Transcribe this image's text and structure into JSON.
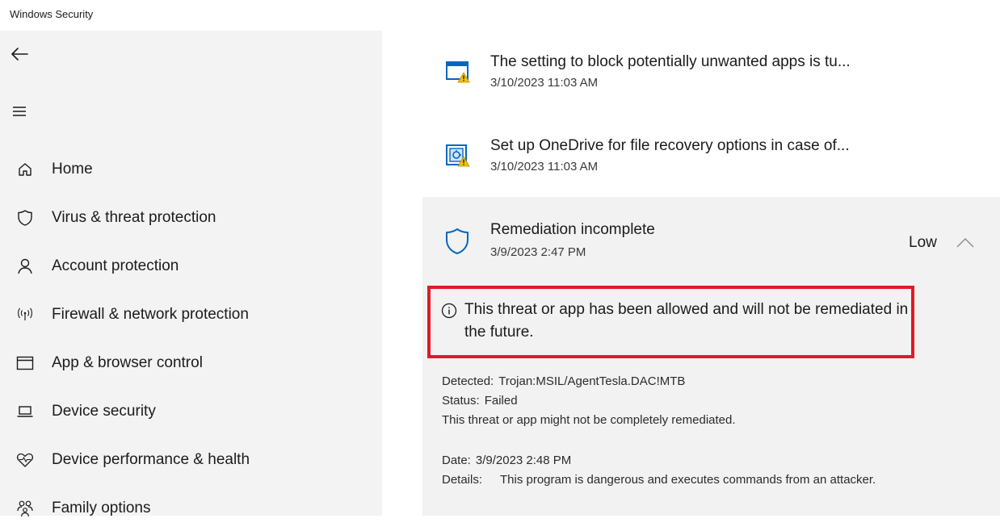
{
  "window": {
    "title": "Windows Security"
  },
  "sidebar": {
    "back_icon": "back-arrow-icon",
    "menu_icon": "hamburger-menu-icon",
    "items": [
      {
        "label": "Home",
        "icon": "home-icon"
      },
      {
        "label": "Virus & threat protection",
        "icon": "shield-icon"
      },
      {
        "label": "Account protection",
        "icon": "person-icon"
      },
      {
        "label": "Firewall & network protection",
        "icon": "antenna-icon"
      },
      {
        "label": "App & browser control",
        "icon": "browser-window-icon"
      },
      {
        "label": "Device security",
        "icon": "laptop-icon"
      },
      {
        "label": "Device performance & health",
        "icon": "heart-pulse-icon"
      },
      {
        "label": "Family options",
        "icon": "family-icon"
      }
    ]
  },
  "history": {
    "entries": [
      {
        "title": "The setting to block potentially unwanted apps is tu...",
        "date": "3/10/2023 11:03 AM",
        "icon": "app-window-warning-icon"
      },
      {
        "title": "Set up OneDrive for file recovery options in case of...",
        "date": "3/10/2023 11:03 AM",
        "icon": "file-recovery-warning-icon"
      }
    ],
    "expanded": {
      "title": "Remediation incomplete",
      "date": "3/9/2023 2:47 PM",
      "severity": "Low",
      "icon": "shield-outline-icon",
      "notice": "This threat or app has been allowed and will not be remediated in the future.",
      "detected_label": "Detected:",
      "detected_value": "Trojan:MSIL/AgentTesla.DAC!MTB",
      "status_label": "Status:",
      "status_value": "Failed",
      "remediation_note": "This threat or app might not be completely remediated.",
      "date_label": "Date:",
      "date_value": "3/9/2023 2:48 PM",
      "details_label": "Details:",
      "details_value": "This program is dangerous and executes commands from an attacker."
    }
  },
  "colors": {
    "accent": "#0067c0",
    "highlight_border": "#e01b24",
    "warning": "#f2c200",
    "sidebar_bg": "#f3f3f3",
    "panel_bg": "#f2f2f2"
  }
}
